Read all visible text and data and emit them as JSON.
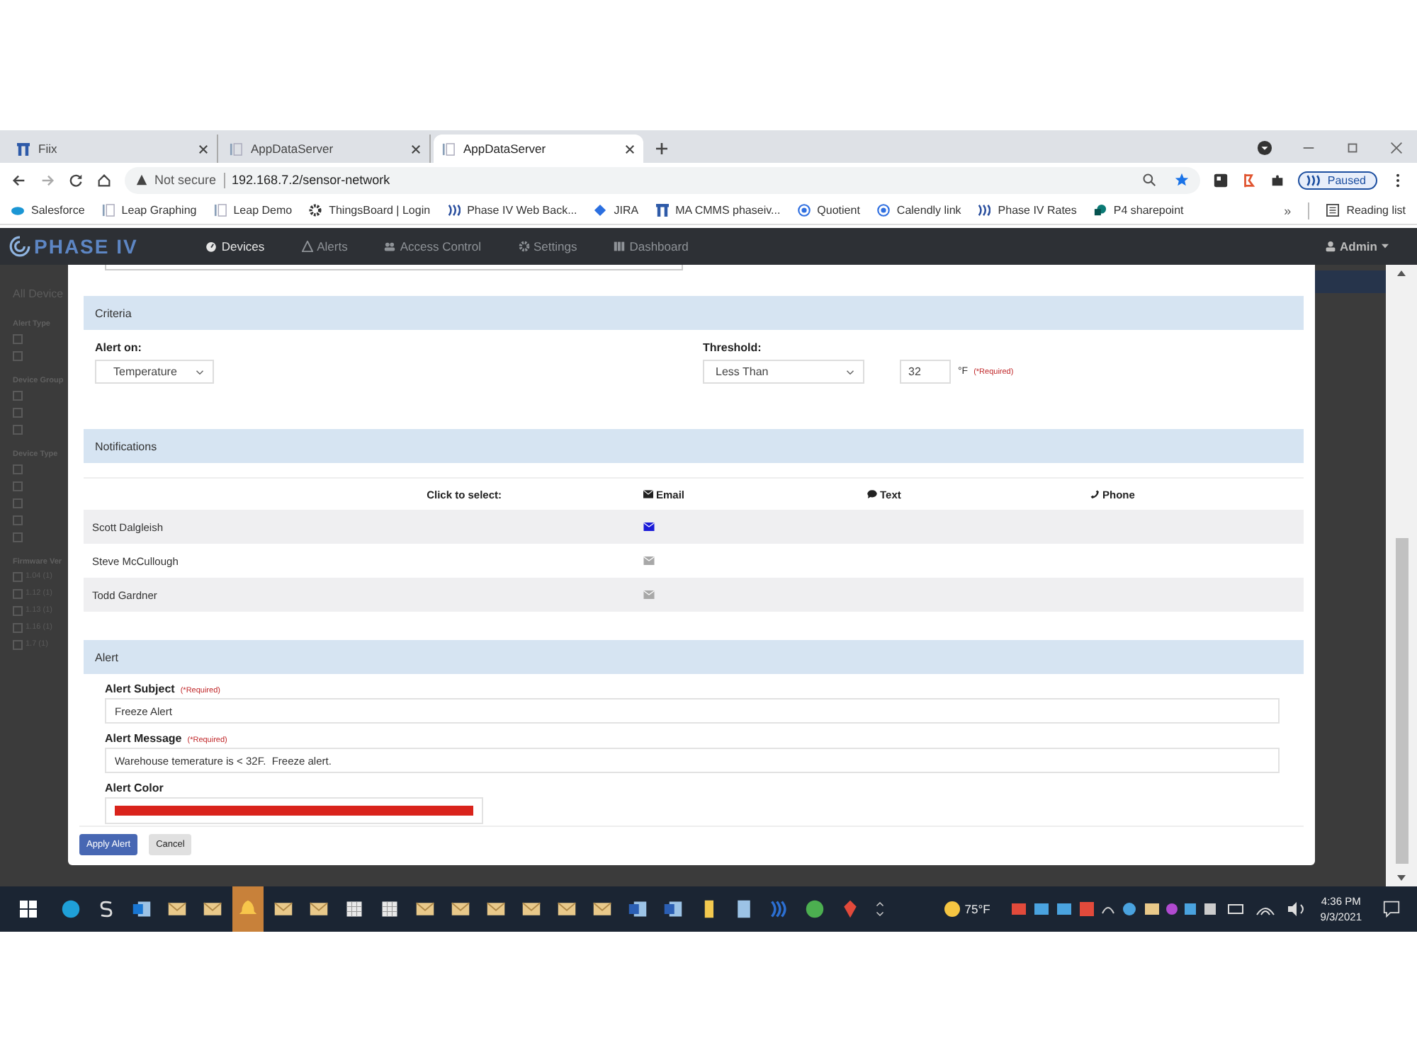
{
  "browser": {
    "tabs": [
      {
        "title": "Fiix",
        "kind": "fiix",
        "selected": false
      },
      {
        "title": "AppDataServer",
        "kind": "page",
        "selected": false
      },
      {
        "title": "AppDataServer",
        "kind": "page",
        "selected": true
      }
    ],
    "address": {
      "security": "Not secure",
      "url": "192.168.7.2/sensor-network"
    },
    "profile": "Paused",
    "bookmarks": [
      {
        "label": "Salesforce",
        "kind": "cloud"
      },
      {
        "label": "Leap Graphing",
        "kind": "page"
      },
      {
        "label": "Leap Demo",
        "kind": "page"
      },
      {
        "label": "ThingsBoard | Login",
        "kind": "gear"
      },
      {
        "label": "Phase IV Web Back...",
        "kind": "waves"
      },
      {
        "label": "JIRA",
        "kind": "diamond"
      },
      {
        "label": "MA CMMS phaseiv...",
        "kind": "fiix"
      },
      {
        "label": "Quotient",
        "kind": "ring"
      },
      {
        "label": "Calendly link",
        "kind": "ring"
      },
      {
        "label": "Phase IV Rates",
        "kind": "waves"
      },
      {
        "label": "P4 sharepoint",
        "kind": "share"
      }
    ],
    "overflow": "»",
    "reading_list": "Reading list"
  },
  "app": {
    "logo": "PHASE IV",
    "nav": [
      {
        "label": "Devices",
        "kind": "gauge",
        "selected": true
      },
      {
        "label": "Alerts",
        "kind": "warning",
        "selected": false
      },
      {
        "label": "Access Control",
        "kind": "users",
        "selected": false
      },
      {
        "label": "Settings",
        "kind": "gear",
        "selected": false
      },
      {
        "label": "Dashboard",
        "kind": "bars",
        "selected": false
      }
    ],
    "user": "Admin"
  },
  "sidebar": {
    "title": "All Device",
    "groups": [
      {
        "heading": "Alert Type",
        "items": [
          {
            "checked": false
          },
          {
            "checked": false
          }
        ]
      },
      {
        "heading": "Device Group",
        "items": [
          {
            "checked": false
          },
          {
            "checked": false
          },
          {
            "checked": false
          }
        ]
      },
      {
        "heading": "Device Type",
        "items": [
          {
            "checked": false
          },
          {
            "checked": false
          },
          {
            "checked": false
          },
          {
            "checked": false
          },
          {
            "checked": false
          }
        ]
      },
      {
        "heading": "Firmware Ver",
        "items": [
          {
            "label": "1.04 (1)",
            "checked": false
          },
          {
            "label": "1.12 (1)",
            "checked": false
          },
          {
            "label": "1.13 (1)",
            "checked": false
          },
          {
            "label": "1.16 (1)",
            "checked": false
          },
          {
            "label": "1.7 (1)",
            "checked": false
          }
        ]
      }
    ]
  },
  "modal": {
    "criteria": {
      "title": "Criteria",
      "alert_on": {
        "label": "Alert on:",
        "value": "Temperature"
      },
      "threshold": {
        "label": "Threshold:",
        "value": "Less Than",
        "amount": "32",
        "unit": "°F",
        "required": "(*Required)"
      }
    },
    "notifications": {
      "title": "Notifications",
      "columns": [
        {
          "label": "Click to select:",
          "kind": "plain"
        },
        {
          "label": "Email",
          "kind": "envelope"
        },
        {
          "label": "Text",
          "kind": "chat"
        },
        {
          "label": "Phone",
          "kind": "phone"
        }
      ],
      "rows": [
        {
          "name": "Scott Dalgleish",
          "email_selected": true
        },
        {
          "name": "Steve McCullough",
          "email_selected": false
        },
        {
          "name": "Todd Gardner",
          "email_selected": false
        }
      ]
    },
    "alert": {
      "title": "Alert",
      "subject": {
        "label": "Alert Subject",
        "required": "(*Required)",
        "value": "Freeze Alert"
      },
      "message": {
        "label": "Alert Message",
        "required": "(*Required)",
        "value": "Warehouse temerature is < 32F.  Freeze alert."
      },
      "color": {
        "label": "Alert Color",
        "color": "#d9231b"
      }
    },
    "buttons": [
      {
        "label": "Apply Alert",
        "kind": "primary"
      },
      {
        "label": "Cancel",
        "kind": "secondary"
      }
    ]
  },
  "taskbar": {
    "apps": [
      {
        "kind": "edge",
        "active": false
      },
      {
        "kind": "s",
        "active": false
      },
      {
        "kind": "outlook",
        "active": false
      },
      {
        "kind": "mail",
        "active": false
      },
      {
        "kind": "mail",
        "active": false
      },
      {
        "kind": "bell",
        "active": true
      },
      {
        "kind": "mail",
        "active": false
      },
      {
        "kind": "mail",
        "active": false
      },
      {
        "kind": "sheet",
        "active": false
      },
      {
        "kind": "sheet",
        "active": false
      },
      {
        "kind": "mail",
        "active": false
      },
      {
        "kind": "mail",
        "active": false
      },
      {
        "kind": "mail",
        "active": false
      },
      {
        "kind": "mail",
        "active": false
      },
      {
        "kind": "mail",
        "active": false
      },
      {
        "kind": "mail",
        "active": false
      },
      {
        "kind": "word",
        "active": false
      },
      {
        "kind": "word",
        "active": false
      },
      {
        "kind": "folder",
        "active": false
      },
      {
        "kind": "doc",
        "active": false
      },
      {
        "kind": "waves",
        "active": false
      },
      {
        "kind": "chrome",
        "active": false
      },
      {
        "kind": "pin",
        "active": false
      }
    ],
    "weather": "75°F",
    "time": "4:36 PM",
    "date": "9/3/2021"
  }
}
